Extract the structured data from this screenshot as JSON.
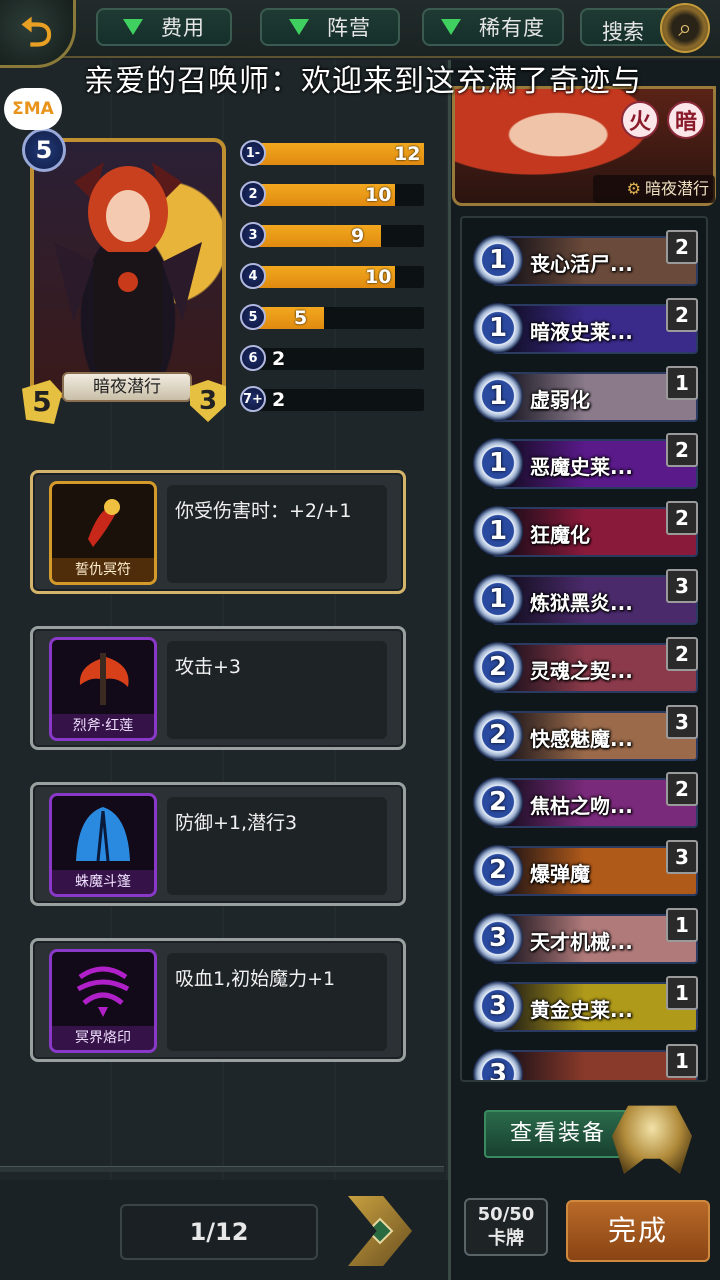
{
  "topbar": {
    "back_icon": "back-arrow-icon",
    "filters": [
      {
        "label": "费用"
      },
      {
        "label": "阵营"
      },
      {
        "label": "稀有度"
      }
    ],
    "search_label": "搜索"
  },
  "marquee": "亲爱的召唤师：欢迎来到这充满了奇迹与",
  "logo_text": "ΣMA",
  "card": {
    "cost": "5",
    "name": "暗夜潜行",
    "attack": "5",
    "health": "3"
  },
  "mana_curve": [
    {
      "cost": "1-",
      "count": "12",
      "fraction": 1.0
    },
    {
      "cost": "2",
      "count": "10",
      "fraction": 0.83
    },
    {
      "cost": "3",
      "count": "9",
      "fraction": 0.75
    },
    {
      "cost": "4",
      "count": "10",
      "fraction": 0.83
    },
    {
      "cost": "5",
      "count": "5",
      "fraction": 0.42
    },
    {
      "cost": "6",
      "count": "2",
      "fraction": 0.0
    },
    {
      "cost": "7+",
      "count": "2",
      "fraction": 0.0
    }
  ],
  "equipment": [
    {
      "name": "誓仇冥符",
      "desc": "你受伤害时：+2/+1",
      "rarity": "gold",
      "icon": "amulet-icon",
      "color": "#c8281a"
    },
    {
      "name": "烈斧·红莲",
      "desc": "攻击+3",
      "rarity": "epic",
      "icon": "axe-icon",
      "color": "#d8401a"
    },
    {
      "name": "蛛魔斗篷",
      "desc": "防御+1,潜行3",
      "rarity": "epic",
      "icon": "cloak-icon",
      "color": "#2a8ae0"
    },
    {
      "name": "冥界烙印",
      "desc": "吸血1,初始魔力+1",
      "rarity": "epic",
      "icon": "sigil-icon",
      "color": "#b020c8"
    }
  ],
  "pager": {
    "label": "1/12"
  },
  "hero": {
    "elements": [
      "火",
      "暗"
    ],
    "name": "暗夜潜行"
  },
  "deck": [
    {
      "cost": "1",
      "name": "丧心活尸...",
      "count": "2",
      "color": "#6a4a3a"
    },
    {
      "cost": "1",
      "name": "暗液史莱...",
      "count": "2",
      "color": "#3a2a8a"
    },
    {
      "cost": "1",
      "name": "虚弱化",
      "count": "1",
      "color": "#8a7a8a"
    },
    {
      "cost": "1",
      "name": "恶魔史莱...",
      "count": "2",
      "color": "#5a1a8a"
    },
    {
      "cost": "1",
      "name": "狂魔化",
      "count": "2",
      "color": "#8a1a3a"
    },
    {
      "cost": "1",
      "name": "炼狱黑炎...",
      "count": "3",
      "color": "#4a2a6a"
    },
    {
      "cost": "2",
      "name": "灵魂之契...",
      "count": "2",
      "color": "#8a3a4a"
    },
    {
      "cost": "2",
      "name": "快感魅魔...",
      "count": "3",
      "color": "#9a6a4a"
    },
    {
      "cost": "2",
      "name": "焦枯之吻...",
      "count": "2",
      "color": "#7a2a7a"
    },
    {
      "cost": "2",
      "name": "爆弹魔",
      "count": "3",
      "color": "#b05a1a"
    },
    {
      "cost": "3",
      "name": "天才机械...",
      "count": "1",
      "color": "#b07a7a"
    },
    {
      "cost": "3",
      "name": "黄金史莱...",
      "count": "1",
      "color": "#b09a1a"
    },
    {
      "cost": "3",
      "name": "",
      "count": "1",
      "color": "#8a3a2a"
    }
  ],
  "view_equipment_label": "查看装备",
  "card_count": {
    "value": "50/50",
    "unit": "卡牌"
  },
  "done_label": "完成"
}
